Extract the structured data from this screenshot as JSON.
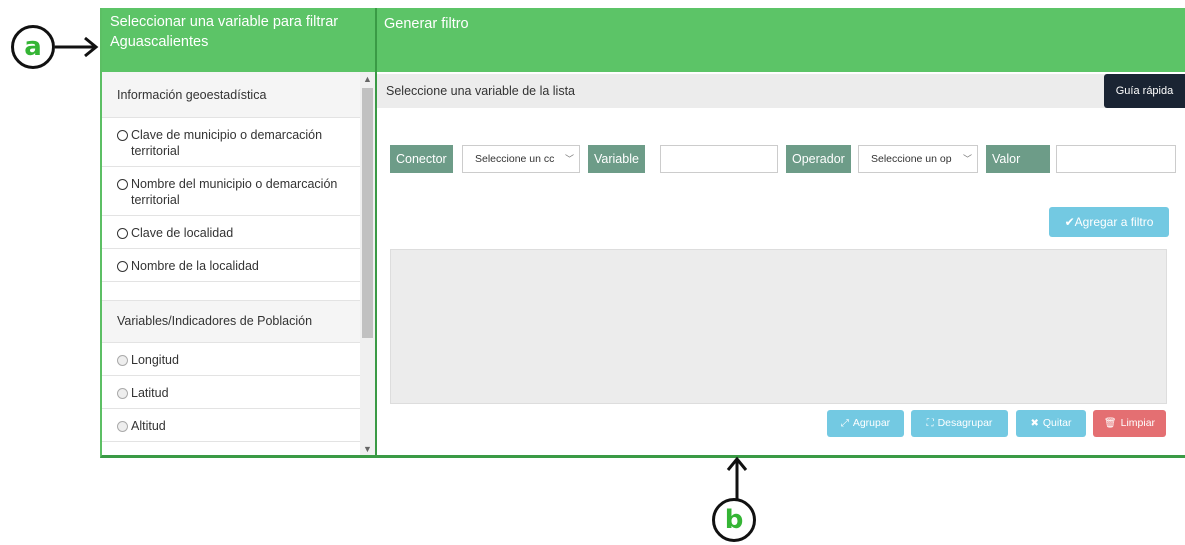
{
  "annotations": {
    "a": "a",
    "b": "b"
  },
  "left_header": {
    "line1": "Seleccionar una variable para filtrar",
    "line2": "Aguascalientes"
  },
  "right_header": {
    "title": "Generar filtro"
  },
  "sidebar": {
    "section1": "Información geoestadística",
    "items1": [
      "Clave de municipio o demarcación territorial",
      "Nombre del municipio o demarcación territorial",
      "Clave de localidad",
      "Nombre de la localidad"
    ],
    "section2": "Variables/Indicadores de Población",
    "items2": [
      "Longitud",
      "Latitud",
      "Altitud"
    ]
  },
  "subbar": {
    "label": "Seleccione una variable de la lista",
    "guide_button": "Guía rápida"
  },
  "filter": {
    "conector_label": "Conector",
    "conector_select": "Seleccione un cc",
    "variable_label": "Variable",
    "operador_label": "Operador",
    "operador_select": "Seleccione un op",
    "valor_label": "Valor",
    "add_button": "✔Agregar a filtro"
  },
  "actions": {
    "agrupar": "Agrupar",
    "desagrupar": "Desagrupar",
    "quitar": "Quitar",
    "limpiar": "Limpiar"
  },
  "colors": {
    "header_green": "#5cc467",
    "tag_green": "#6d9c88",
    "info_blue": "#5bc0de",
    "danger_red": "#e0575a",
    "guide_dark": "#1a2433"
  }
}
